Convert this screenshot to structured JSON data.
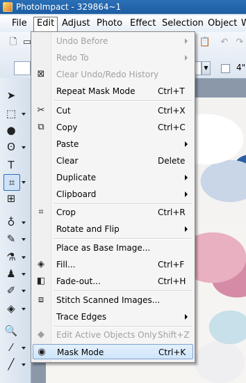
{
  "window": {
    "title": "PhotoImpact - 329864~1"
  },
  "menubar": {
    "items": [
      "File",
      "Edit",
      "Adjust",
      "Photo",
      "Effect",
      "Selection",
      "Object",
      "W"
    ],
    "active": "Edit"
  },
  "toolbar": {
    "size_value": "4\""
  },
  "edit_menu": {
    "items": [
      {
        "label": "Undo Before",
        "shortcut": "",
        "submenu": true,
        "disabled": true,
        "icon": ""
      },
      {
        "label": "Redo To",
        "shortcut": "",
        "submenu": true,
        "disabled": true,
        "icon": ""
      },
      {
        "label": "Clear Undo/Redo History",
        "shortcut": "",
        "submenu": false,
        "disabled": true,
        "icon": "clear-history-icon"
      },
      {
        "label": "Repeat Mask Mode",
        "shortcut": "Ctrl+T",
        "submenu": false,
        "disabled": false,
        "icon": ""
      },
      {
        "label": "Cut",
        "shortcut": "Ctrl+X",
        "submenu": false,
        "disabled": false,
        "icon": "scissors-icon"
      },
      {
        "label": "Copy",
        "shortcut": "Ctrl+C",
        "submenu": false,
        "disabled": false,
        "icon": "copy-icon"
      },
      {
        "label": "Paste",
        "shortcut": "",
        "submenu": true,
        "disabled": false,
        "icon": ""
      },
      {
        "label": "Clear",
        "shortcut": "Delete",
        "submenu": false,
        "disabled": false,
        "icon": ""
      },
      {
        "label": "Duplicate",
        "shortcut": "",
        "submenu": true,
        "disabled": false,
        "icon": ""
      },
      {
        "label": "Clipboard",
        "shortcut": "",
        "submenu": true,
        "disabled": false,
        "icon": ""
      },
      {
        "label": "Crop",
        "shortcut": "Ctrl+R",
        "submenu": false,
        "disabled": false,
        "icon": "crop-icon"
      },
      {
        "label": "Rotate and Flip",
        "shortcut": "",
        "submenu": true,
        "disabled": false,
        "icon": ""
      },
      {
        "label": "Place as Base Image...",
        "shortcut": "",
        "submenu": false,
        "disabled": false,
        "icon": ""
      },
      {
        "label": "Fill...",
        "shortcut": "Ctrl+F",
        "submenu": false,
        "disabled": false,
        "icon": "fill-bucket-icon"
      },
      {
        "label": "Fade-out...",
        "shortcut": "Ctrl+H",
        "submenu": false,
        "disabled": false,
        "icon": "fade-out-icon"
      },
      {
        "label": "Stitch Scanned Images...",
        "shortcut": "",
        "submenu": false,
        "disabled": false,
        "icon": "stitch-icon"
      },
      {
        "label": "Trace Edges",
        "shortcut": "",
        "submenu": true,
        "disabled": false,
        "icon": ""
      },
      {
        "label": "Edit Active Objects Only",
        "shortcut": "Shift+Z",
        "submenu": false,
        "disabled": true,
        "icon": "edit-objects-icon"
      },
      {
        "label": "Mask Mode",
        "shortcut": "Ctrl+K",
        "submenu": false,
        "disabled": false,
        "icon": "mask-mode-icon",
        "highlighted": true
      }
    ]
  }
}
